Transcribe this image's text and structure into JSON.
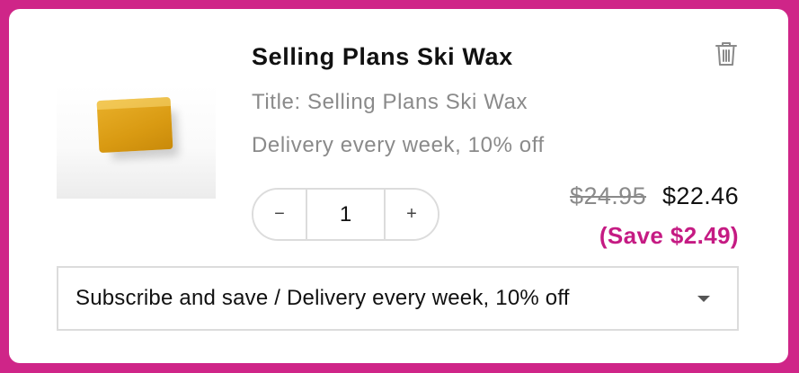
{
  "product": {
    "title": "Selling Plans Ski Wax",
    "image_alt": "yellow wax bar",
    "options": [
      "Title: Selling Plans Ski Wax",
      "Delivery every week, 10% off"
    ]
  },
  "remove": {
    "icon": "trash-icon"
  },
  "quantity": {
    "decrement_label": "−",
    "value": "1",
    "increment_label": "+"
  },
  "pricing": {
    "original_price": "$24.95",
    "sale_price": "$22.46",
    "savings": "(Save $2.49)"
  },
  "selling_plan": {
    "selected": "Subscribe and save / Delivery every week, 10% off",
    "icon": "chevron-down-icon"
  },
  "colors": {
    "background": "#cf2588",
    "accent": "#c51b83",
    "muted_text": "#8a8a8a"
  }
}
